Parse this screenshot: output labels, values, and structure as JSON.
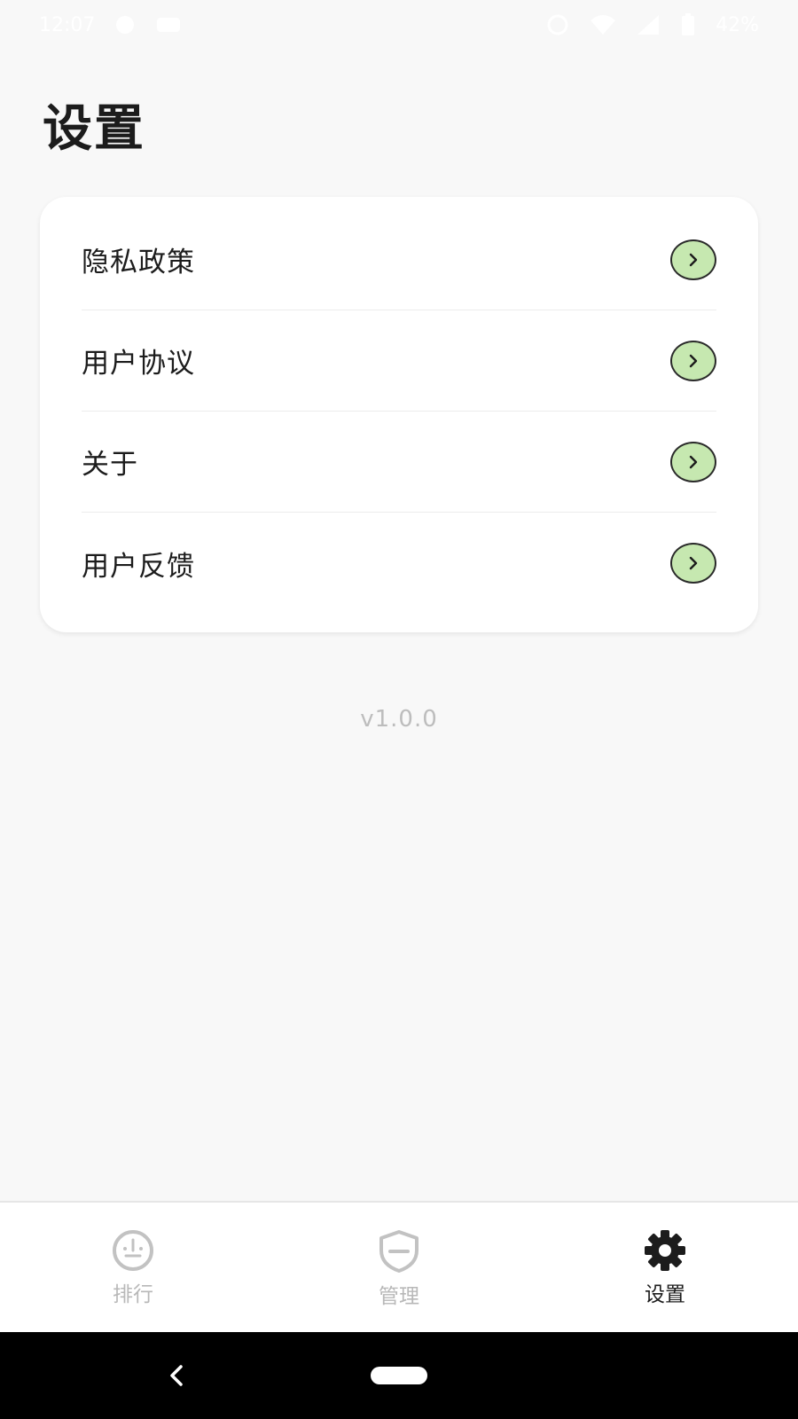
{
  "status_bar": {
    "time": "12:07",
    "battery": "42%"
  },
  "page": {
    "title": "设置",
    "version": "v1.0.0"
  },
  "settings": {
    "items": [
      {
        "label": "隐私政策"
      },
      {
        "label": "用户协议"
      },
      {
        "label": "关于"
      },
      {
        "label": "用户反馈"
      }
    ],
    "arrow_color": "#c6e8b0"
  },
  "bottom_nav": {
    "items": [
      {
        "label": "排行",
        "icon": "gauge-icon",
        "active": false
      },
      {
        "label": "管理",
        "icon": "shield-icon",
        "active": false
      },
      {
        "label": "设置",
        "icon": "gear-icon",
        "active": true
      }
    ]
  }
}
